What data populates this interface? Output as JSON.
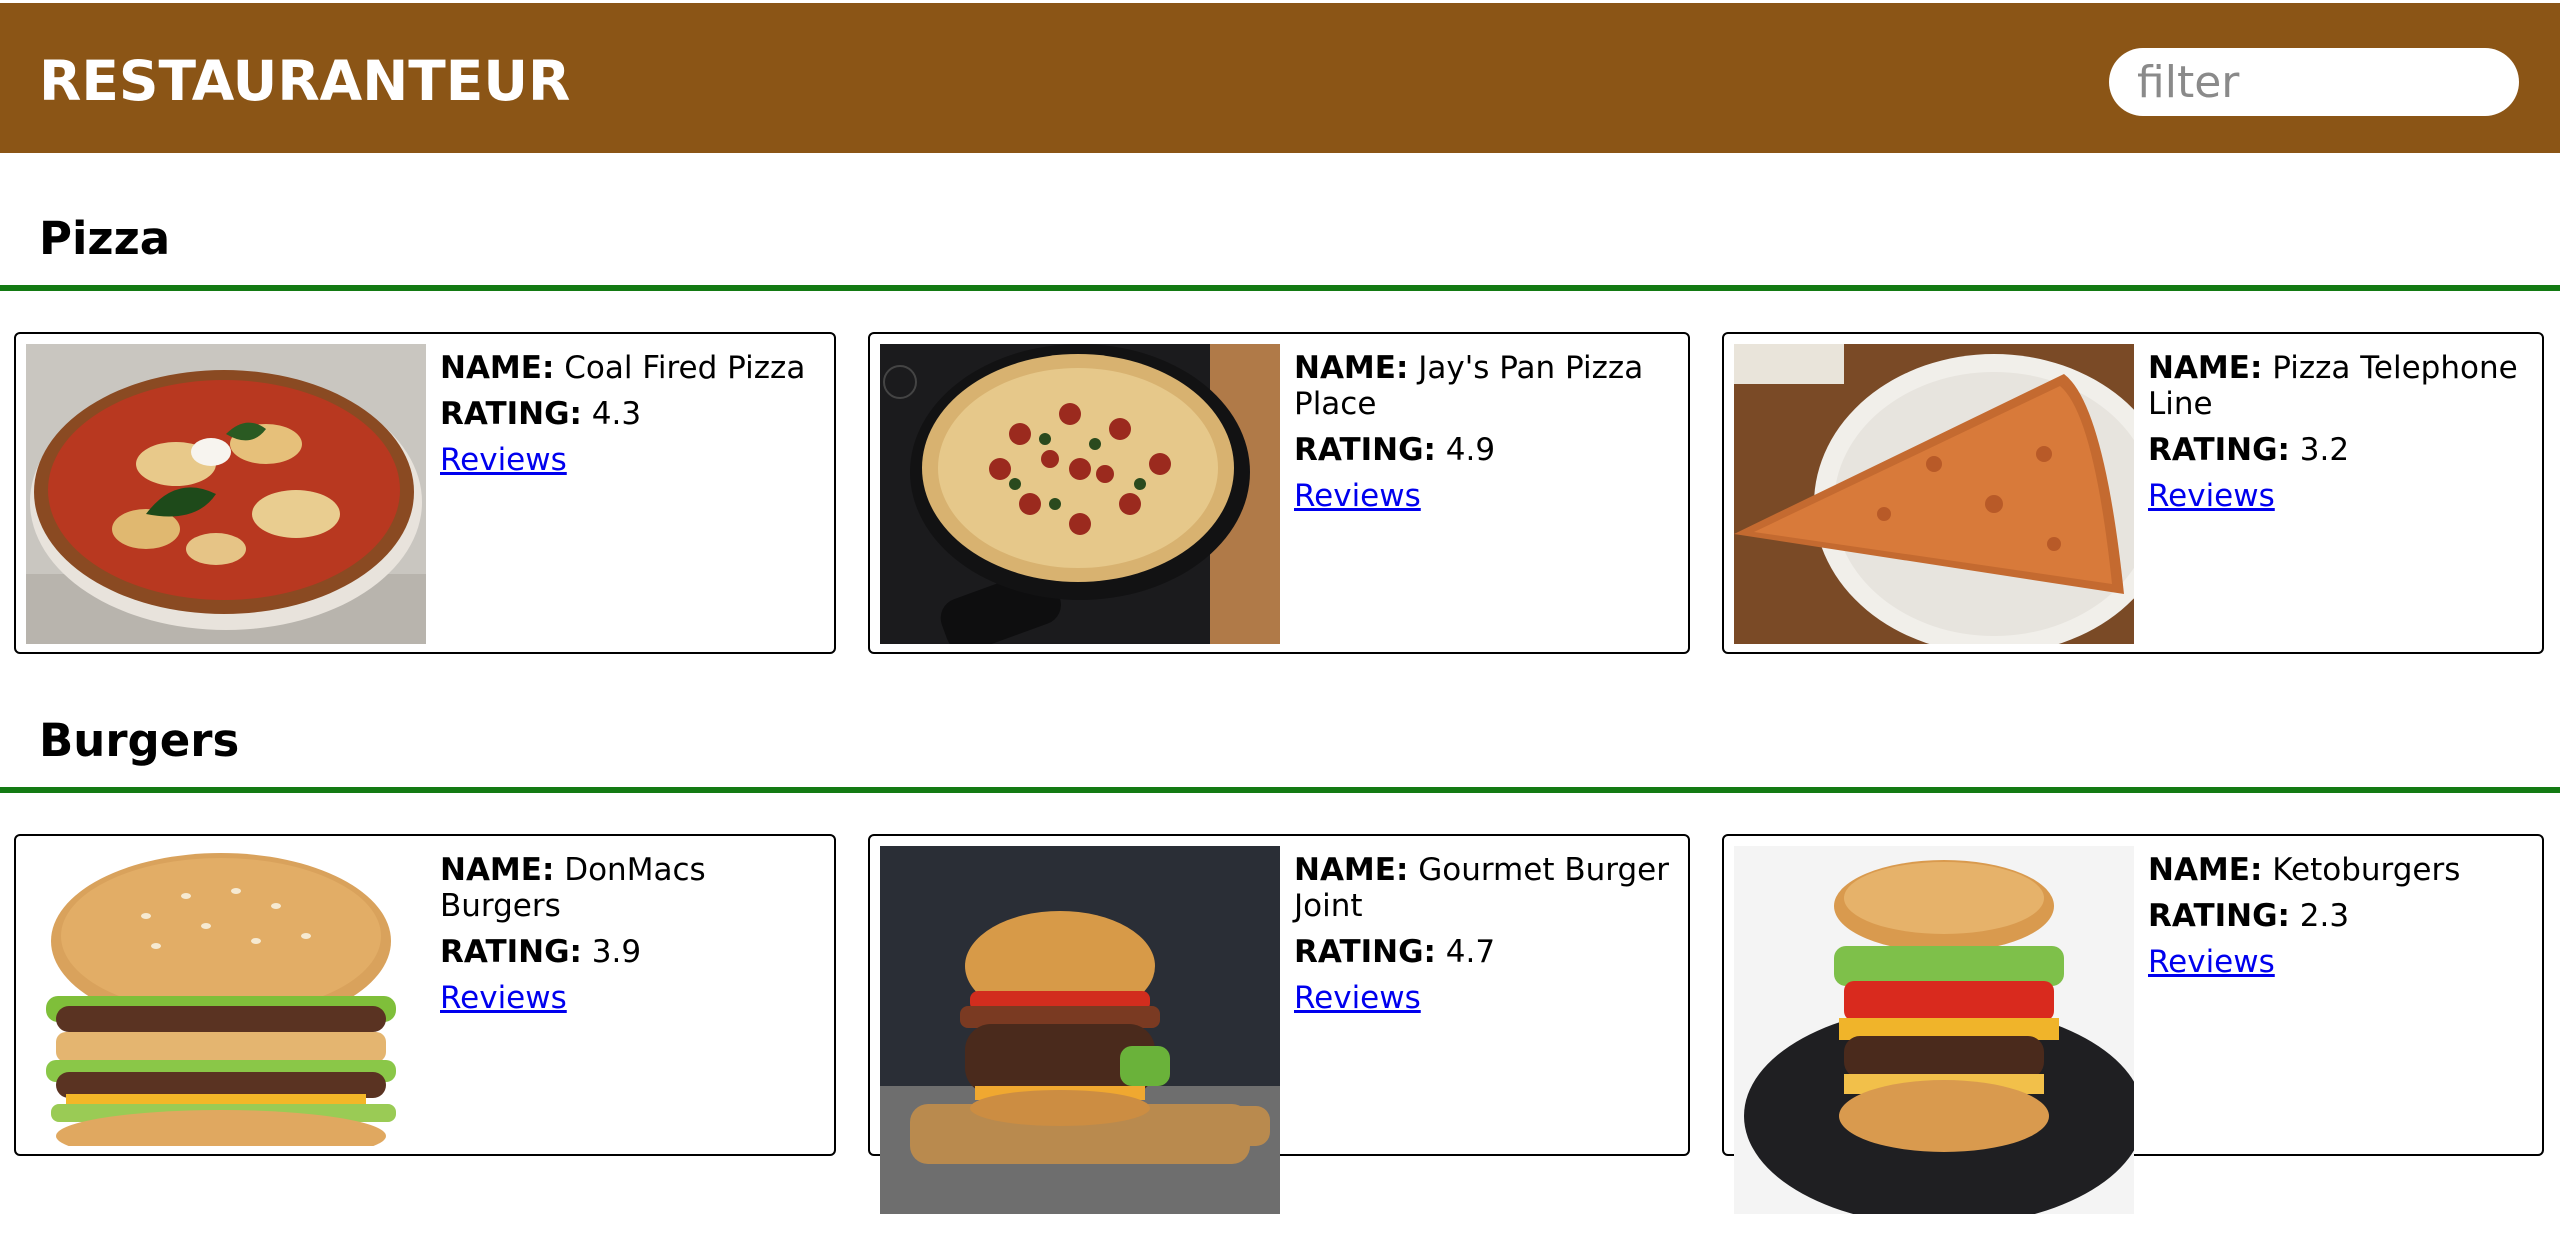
{
  "header": {
    "title": "RESTAURANTEUR",
    "filter_placeholder": "filter",
    "filter_value": ""
  },
  "labels": {
    "name": "NAME:",
    "rating": "RATING:",
    "reviews": "Reviews"
  },
  "sections": [
    {
      "title": "Pizza",
      "restaurants": [
        {
          "name": "Coal Fired Pizza",
          "rating": "4.3",
          "photo": "margherita-pizza-photo"
        },
        {
          "name": "Jay's Pan Pizza Place",
          "rating": "4.9",
          "photo": "pan-pizza-skillet-photo"
        },
        {
          "name": "Pizza Telephone Line",
          "rating": "3.2",
          "photo": "pizza-slice-plate-photo"
        }
      ]
    },
    {
      "title": "Burgers",
      "restaurants": [
        {
          "name": "DonMacs Burgers",
          "rating": "3.9",
          "photo": "double-burger-photo"
        },
        {
          "name": "Gourmet Burger Joint",
          "rating": "4.7",
          "photo": "gourmet-burger-board-photo"
        },
        {
          "name": "Ketoburgers",
          "rating": "2.3",
          "photo": "keto-burger-photo"
        }
      ]
    }
  ],
  "colors": {
    "header_bg": "#8b5516",
    "divider": "#137a13",
    "link": "#0000ee"
  }
}
